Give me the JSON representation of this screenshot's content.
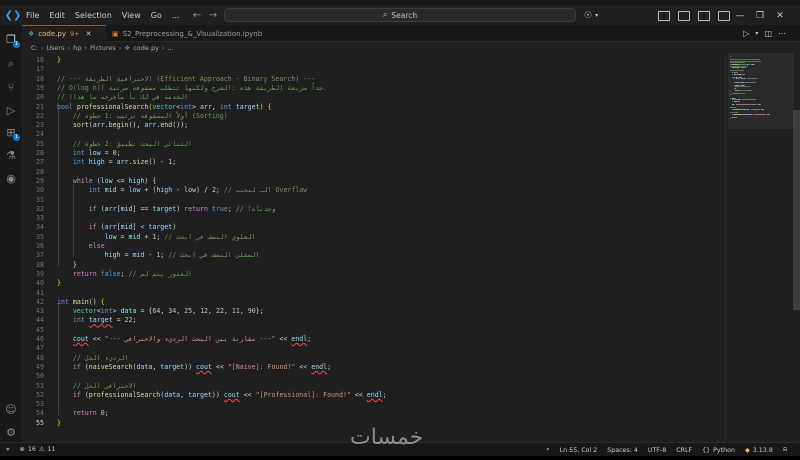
{
  "titlebar": {
    "menus": [
      "File",
      "Edit",
      "Selection",
      "View",
      "Go",
      "..."
    ],
    "search_label": "Search"
  },
  "tabs": [
    {
      "label": "code.py",
      "modified": "9+",
      "active": true
    },
    {
      "label": "S2_Preprocessing_&_Visualization.ipynb",
      "active": false
    }
  ],
  "breadcrumb": [
    "C:",
    "Users",
    "hp",
    "Pictures",
    "code.py",
    "..."
  ],
  "editor": {
    "current_line": 55,
    "lines": [
      {
        "n": "16",
        "t": [
          [
            "}",
            "tok-br"
          ]
        ]
      },
      {
        "n": "17",
        "t": []
      },
      {
        "n": "18",
        "t": [
          [
            "// --- الاحترافية الطريقة (Efficient Approach - Binary Search) ---",
            "tok-cm"
          ]
        ]
      },
      {
        "n": "19",
        "t": [
          [
            "// O(log n)) جداً سريعة الطريقة هذه :الشرح ولكنها تتطلب مصفوفة مرتبة.",
            "tok-cm"
          ]
        ]
      },
      {
        "n": "20",
        "t": [
          [
            "// !الخدمة في لك نأ مأخرجه ما هذا",
            "tok-cm"
          ]
        ]
      },
      {
        "n": "21",
        "t": [
          [
            "bool ",
            "tok-kw"
          ],
          [
            "professionalSearch",
            "tok-fn"
          ],
          [
            "(",
            "tok-br"
          ],
          [
            "vector",
            "tok-type"
          ],
          [
            "<",
            "tok-pl"
          ],
          [
            "int",
            "tok-kw"
          ],
          [
            "> ",
            "tok-pl"
          ],
          [
            "arr",
            "tok-var"
          ],
          [
            ", ",
            "tok-pl"
          ],
          [
            "int ",
            "tok-kw"
          ],
          [
            "target",
            "tok-var"
          ],
          [
            ") {",
            "tok-br"
          ]
        ]
      },
      {
        "n": "22",
        "t": [
          [
            "    // أولاً المصفوفة ترتيب :1 خطوة (Sorting)",
            "tok-cm"
          ]
        ]
      },
      {
        "n": "23",
        "t": [
          [
            "    ",
            "tok-pl"
          ],
          [
            "sort",
            "tok-fn"
          ],
          [
            "(",
            "tok-pl"
          ],
          [
            "arr",
            "tok-var"
          ],
          [
            ".",
            "tok-pl"
          ],
          [
            "begin",
            "tok-fn"
          ],
          [
            "(), ",
            "tok-pl"
          ],
          [
            "arr",
            "tok-var"
          ],
          [
            ".",
            "tok-pl"
          ],
          [
            "end",
            "tok-fn"
          ],
          [
            "());",
            "tok-pl"
          ]
        ]
      },
      {
        "n": "24",
        "t": []
      },
      {
        "n": "25",
        "t": [
          [
            "    // الثنائي البحث تطبيق :2 خطوة",
            "tok-cm"
          ]
        ]
      },
      {
        "n": "26",
        "t": [
          [
            "    ",
            "tok-pl"
          ],
          [
            "int ",
            "tok-kw"
          ],
          [
            "low",
            "tok-var"
          ],
          [
            " = ",
            "tok-pl"
          ],
          [
            "0",
            "tok-num"
          ],
          [
            ";",
            "tok-pl"
          ]
        ]
      },
      {
        "n": "27",
        "t": [
          [
            "    ",
            "tok-pl"
          ],
          [
            "int ",
            "tok-kw"
          ],
          [
            "high",
            "tok-var"
          ],
          [
            " = ",
            "tok-pl"
          ],
          [
            "arr",
            "tok-var"
          ],
          [
            ".",
            "tok-pl"
          ],
          [
            "size",
            "tok-fn"
          ],
          [
            "() - ",
            "tok-pl"
          ],
          [
            "1",
            "tok-num"
          ],
          [
            ";",
            "tok-pl"
          ]
        ]
      },
      {
        "n": "28",
        "t": []
      },
      {
        "n": "29",
        "t": [
          [
            "    ",
            "tok-pl"
          ],
          [
            "while ",
            "tok-ctl"
          ],
          [
            "(",
            "tok-pl"
          ],
          [
            "low",
            "tok-var"
          ],
          [
            " <= ",
            "tok-pl"
          ],
          [
            "high",
            "tok-var"
          ],
          [
            ") {",
            "tok-pl"
          ]
        ]
      },
      {
        "n": "30",
        "t": [
          [
            "        ",
            "tok-pl"
          ],
          [
            "int ",
            "tok-kw"
          ],
          [
            "mid",
            "tok-var"
          ],
          [
            " = ",
            "tok-pl"
          ],
          [
            "low",
            "tok-var"
          ],
          [
            " + (",
            "tok-pl"
          ],
          [
            "high",
            "tok-var"
          ],
          [
            " - ",
            "tok-pl"
          ],
          [
            "low",
            "tok-var"
          ],
          [
            ") / ",
            "tok-pl"
          ],
          [
            "2",
            "tok-num"
          ],
          [
            "; ",
            "tok-pl"
          ],
          [
            "// الـ لتجنب Overflow",
            "tok-cm"
          ]
        ]
      },
      {
        "n": "31",
        "t": []
      },
      {
        "n": "32",
        "t": [
          [
            "        ",
            "tok-pl"
          ],
          [
            "if ",
            "tok-ctl"
          ],
          [
            "(",
            "tok-pl"
          ],
          [
            "arr",
            "tok-var"
          ],
          [
            "[",
            "tok-pl"
          ],
          [
            "mid",
            "tok-var"
          ],
          [
            "] == ",
            "tok-pl"
          ],
          [
            "target",
            "tok-var"
          ],
          [
            ") ",
            "tok-pl"
          ],
          [
            "return ",
            "tok-ctl"
          ],
          [
            "true",
            "tok-kw"
          ],
          [
            "; ",
            "tok-pl"
          ],
          [
            "// !وجدناه",
            "tok-cm"
          ]
        ]
      },
      {
        "n": "33",
        "t": []
      },
      {
        "n": "34",
        "t": [
          [
            "        ",
            "tok-pl"
          ],
          [
            "if ",
            "tok-ctl"
          ],
          [
            "(",
            "tok-pl"
          ],
          [
            "arr",
            "tok-var"
          ],
          [
            "[",
            "tok-pl"
          ],
          [
            "mid",
            "tok-var"
          ],
          [
            "] < ",
            "tok-pl"
          ],
          [
            "target",
            "tok-var"
          ],
          [
            ")",
            "tok-pl"
          ]
        ]
      },
      {
        "n": "35",
        "t": [
          [
            "            ",
            "tok-pl"
          ],
          [
            "low",
            "tok-var"
          ],
          [
            " = ",
            "tok-pl"
          ],
          [
            "mid",
            "tok-var"
          ],
          [
            " + ",
            "tok-pl"
          ],
          [
            "1",
            "tok-num"
          ],
          [
            "; ",
            "tok-pl"
          ],
          [
            "// العلوي النصف في ابحث",
            "tok-cm"
          ]
        ]
      },
      {
        "n": "36",
        "t": [
          [
            "        ",
            "tok-pl"
          ],
          [
            "else",
            "tok-ctl"
          ]
        ]
      },
      {
        "n": "37",
        "t": [
          [
            "            ",
            "tok-pl"
          ],
          [
            "high",
            "tok-var"
          ],
          [
            " = ",
            "tok-pl"
          ],
          [
            "mid",
            "tok-var"
          ],
          [
            " - ",
            "tok-pl"
          ],
          [
            "1",
            "tok-num"
          ],
          [
            "; ",
            "tok-pl"
          ],
          [
            "// السفلي النصف في ابحث",
            "tok-cm"
          ]
        ]
      },
      {
        "n": "38",
        "t": [
          [
            "    }",
            "tok-pl"
          ]
        ]
      },
      {
        "n": "39",
        "t": [
          [
            "    ",
            "tok-pl"
          ],
          [
            "return ",
            "tok-ctl"
          ],
          [
            "false",
            "tok-kw"
          ],
          [
            "; ",
            "tok-pl"
          ],
          [
            "// العثور يتم لم",
            "tok-cm"
          ]
        ]
      },
      {
        "n": "40",
        "t": [
          [
            "}",
            "tok-br"
          ]
        ]
      },
      {
        "n": "41",
        "t": []
      },
      {
        "n": "42",
        "t": [
          [
            "int ",
            "tok-kw"
          ],
          [
            "main",
            "tok-fn"
          ],
          [
            "() ",
            "tok-pl"
          ],
          [
            "{",
            "tok-br"
          ]
        ]
      },
      {
        "n": "43",
        "t": [
          [
            "    ",
            "tok-pl"
          ],
          [
            "vector",
            "tok-type"
          ],
          [
            "<",
            "tok-pl"
          ],
          [
            "int",
            "tok-kw"
          ],
          [
            "> ",
            "tok-pl"
          ],
          [
            "data",
            "tok-var"
          ],
          [
            " = {",
            "tok-pl"
          ],
          [
            "64",
            "tok-num"
          ],
          [
            ", ",
            "tok-pl"
          ],
          [
            "34",
            "tok-num"
          ],
          [
            ", ",
            "tok-pl"
          ],
          [
            "25",
            "tok-num"
          ],
          [
            ", ",
            "tok-pl"
          ],
          [
            "12",
            "tok-num"
          ],
          [
            ", ",
            "tok-pl"
          ],
          [
            "22",
            "tok-num"
          ],
          [
            ", ",
            "tok-pl"
          ],
          [
            "11",
            "tok-num"
          ],
          [
            ", ",
            "tok-pl"
          ],
          [
            "90",
            "tok-num"
          ],
          [
            "};",
            "tok-pl"
          ]
        ]
      },
      {
        "n": "44",
        "t": [
          [
            "    ",
            "tok-pl"
          ],
          [
            "int ",
            "tok-kw"
          ],
          [
            "target",
            "tok-var"
          ],
          [
            " = ",
            "tok-pl"
          ],
          [
            "22",
            "tok-num"
          ],
          [
            ";",
            "tok-pl"
          ]
        ]
      },
      {
        "n": "45",
        "t": []
      },
      {
        "n": "46",
        "t": [
          [
            "    ",
            "tok-pl"
          ],
          [
            "cout",
            "tok-var"
          ],
          [
            " << ",
            "tok-pl"
          ],
          [
            "\"--- مقارنة بين البحث الرديء والاحترافي ---\"",
            "tok-str"
          ],
          [
            " << ",
            "tok-pl"
          ],
          [
            "endl",
            "tok-var"
          ],
          [
            ";",
            "tok-pl"
          ]
        ]
      },
      {
        "n": "47",
        "t": []
      },
      {
        "n": "48",
        "t": [
          [
            "    // الرديء الحل",
            "tok-cm"
          ]
        ]
      },
      {
        "n": "49",
        "t": [
          [
            "    ",
            "tok-pl"
          ],
          [
            "if ",
            "tok-ctl"
          ],
          [
            "(",
            "tok-pl"
          ],
          [
            "naiveSearch",
            "tok-fn"
          ],
          [
            "(",
            "tok-pl"
          ],
          [
            "data",
            "tok-var"
          ],
          [
            ", ",
            "tok-pl"
          ],
          [
            "target",
            "tok-var"
          ],
          [
            ")) ",
            "tok-pl"
          ],
          [
            "cout",
            "tok-var"
          ],
          [
            " << ",
            "tok-pl"
          ],
          [
            "\"[Naive]: Found!\"",
            "tok-str"
          ],
          [
            " << ",
            "tok-pl"
          ],
          [
            "endl",
            "tok-var"
          ],
          [
            ";",
            "tok-pl"
          ]
        ]
      },
      {
        "n": "50",
        "t": []
      },
      {
        "n": "51",
        "t": [
          [
            "    // الاحترافي الحل",
            "tok-cm"
          ]
        ]
      },
      {
        "n": "52",
        "t": [
          [
            "    ",
            "tok-pl"
          ],
          [
            "if ",
            "tok-ctl"
          ],
          [
            "(",
            "tok-pl"
          ],
          [
            "professionalSearch",
            "tok-fn"
          ],
          [
            "(",
            "tok-pl"
          ],
          [
            "data",
            "tok-var"
          ],
          [
            ", ",
            "tok-pl"
          ],
          [
            "target",
            "tok-var"
          ],
          [
            ")) ",
            "tok-pl"
          ],
          [
            "cout",
            "tok-var"
          ],
          [
            " << ",
            "tok-pl"
          ],
          [
            "\"[Professional]: Found!\"",
            "tok-str"
          ],
          [
            " << ",
            "tok-pl"
          ],
          [
            "endl",
            "tok-var"
          ],
          [
            ";",
            "tok-pl"
          ]
        ]
      },
      {
        "n": "53",
        "t": []
      },
      {
        "n": "54",
        "t": [
          [
            "    ",
            "tok-pl"
          ],
          [
            "return ",
            "tok-ctl"
          ],
          [
            "0",
            "tok-num"
          ],
          [
            ";",
            "tok-pl"
          ]
        ]
      },
      {
        "n": "55",
        "t": [
          [
            "}",
            "tok-br"
          ]
        ]
      }
    ]
  },
  "statusbar": {
    "errors": "16",
    "warnings": "11",
    "position": "Ln 55, Col 2",
    "spaces": "Spaces: 4",
    "encoding": "UTF-8",
    "eol": "CRLF",
    "language": "Python",
    "version": "3.13.8"
  },
  "watermark": "خمسات",
  "colors": {
    "accent": "#0078d4",
    "editor_bg": "#1f1f1f",
    "error": "#f14c4c"
  }
}
